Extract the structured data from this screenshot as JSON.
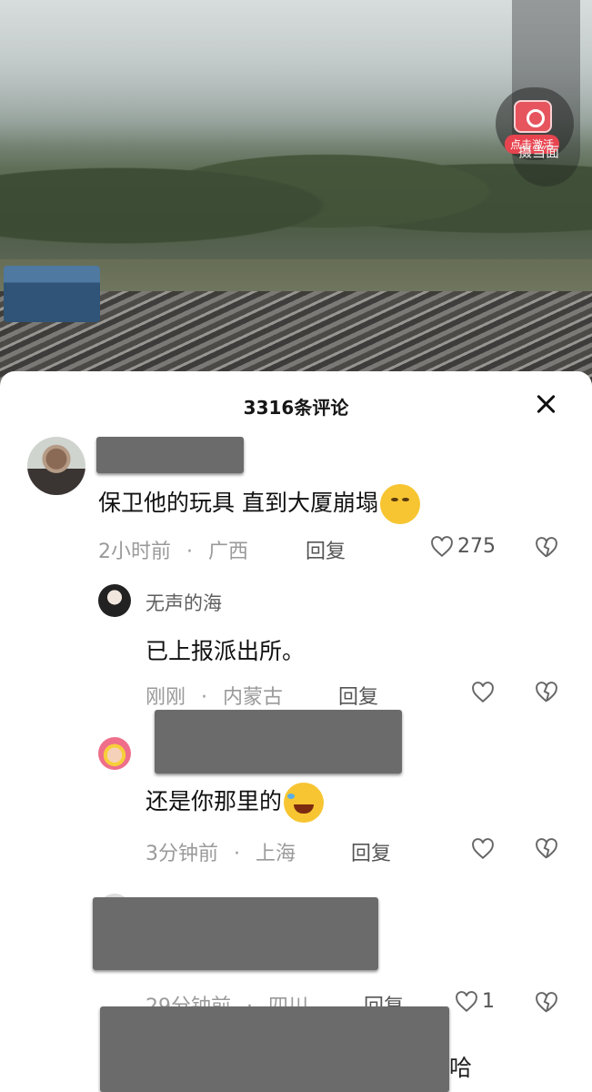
{
  "video": {
    "activate_label": "点击激活",
    "activate_sub": "摄当面"
  },
  "sheet": {
    "title": "3316条评论"
  },
  "comments": [
    {
      "text": "保卫他的玩具 直到大厦崩塌",
      "emoji": "smirk-face-icon",
      "time": "2小时前",
      "location": "广西",
      "reply_label": "回复",
      "likes": "275"
    },
    {
      "author": "无声的海",
      "text": "已上报派出所。",
      "time": "刚刚",
      "location": "内蒙古",
      "reply_label": "回复"
    },
    {
      "text": "还是你那里的",
      "emoji": "rolling-laughing-face-icon",
      "time": "3分钟前",
      "location": "上海",
      "reply_label": "回复"
    },
    {
      "time": "29分钟前",
      "location": "四川",
      "reply_label": "回复",
      "likes": "1"
    }
  ],
  "partial_tail_text": "哈",
  "meta_separator": "·",
  "colors": {
    "redaction": "#6b6b6b",
    "sheet_bg": "#ffffff",
    "meta_text": "#9a9a9a"
  }
}
